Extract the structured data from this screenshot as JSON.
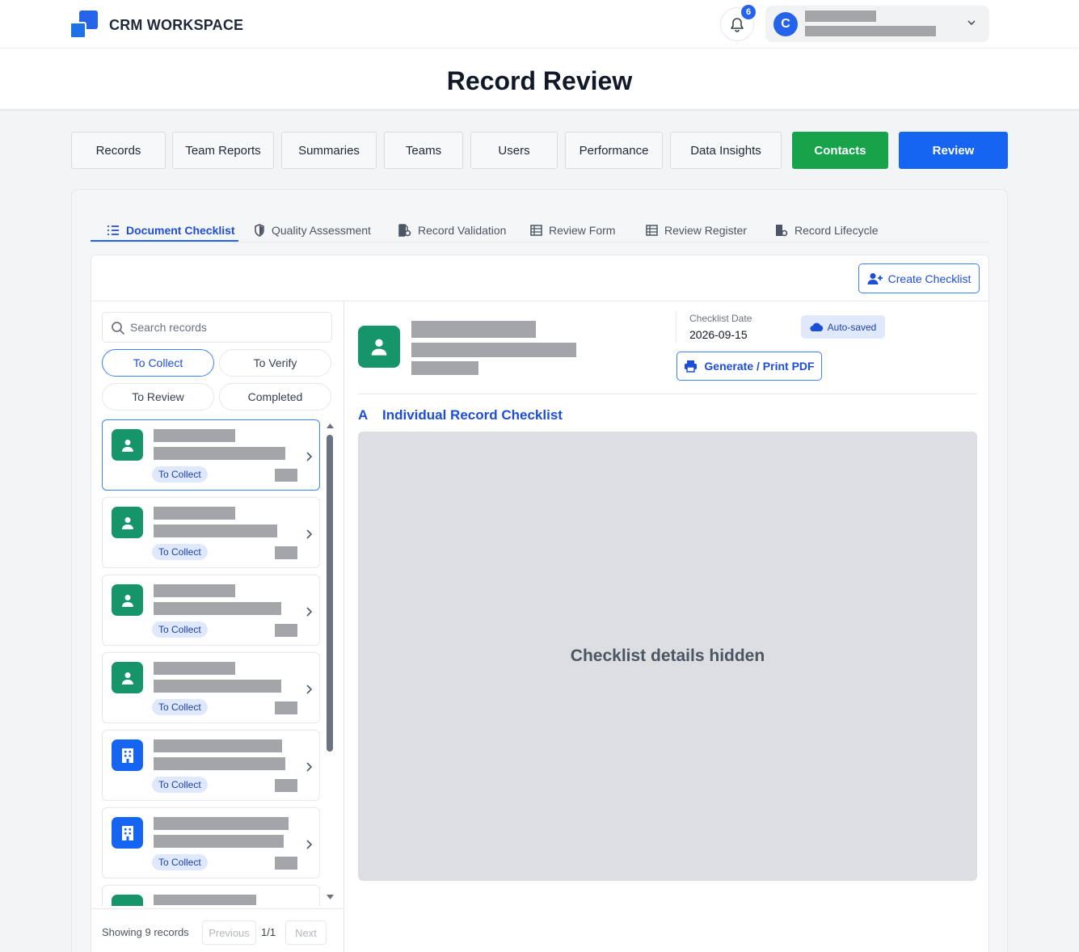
{
  "app": {
    "brand": "CRM WORKSPACE",
    "notifications": "6",
    "user_initial": "C"
  },
  "page": {
    "title": "Record Review"
  },
  "nav": [
    "Records",
    "Team Reports",
    "Summaries",
    "Teams",
    "Users",
    "Performance",
    "Data Insights",
    "Contacts",
    "Review"
  ],
  "subtabs": [
    "Document Checklist",
    "Quality Assessment",
    "Record Validation",
    "Review Form",
    "Review Register",
    "Record Lifecycle"
  ],
  "toolbar": {
    "create_label": "Create Checklist"
  },
  "search": {
    "placeholder": "Search records",
    "value": ""
  },
  "filters": [
    "To Collect",
    "To Verify",
    "To Review",
    "Completed"
  ],
  "records": [
    {
      "status": "To Collect",
      "icon": "person-icon"
    },
    {
      "status": "To Collect",
      "icon": "person-icon"
    },
    {
      "status": "To Collect",
      "icon": "person-icon"
    },
    {
      "status": "To Collect",
      "icon": "person-icon"
    },
    {
      "status": "To Collect",
      "icon": "building-icon"
    },
    {
      "status": "To Collect",
      "icon": "building-icon"
    }
  ],
  "pagination": {
    "showing": "Showing 9 records",
    "previous": "Previous",
    "page": "1/1",
    "next": "Next"
  },
  "detail": {
    "date_label": "Checklist Date",
    "date_value": "2026-09-15",
    "autosaved": "Auto-saved",
    "print_label": "Generate / Print PDF",
    "section_letter": "A",
    "section_title": "Individual Record Checklist",
    "hidden_text": "Checklist details hidden"
  },
  "colors": {
    "accent": "#1565f2",
    "green": "#16a34a",
    "record_green": "#16956a"
  }
}
